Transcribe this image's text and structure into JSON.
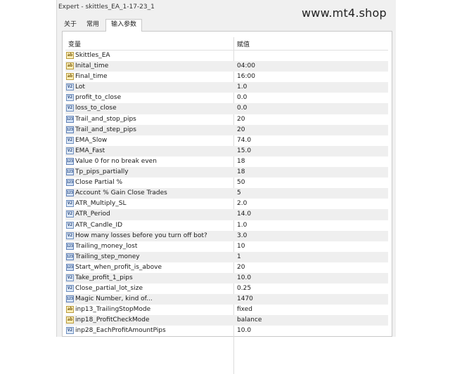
{
  "window": {
    "title": "Expert - skittles_EA_1-17-23_1",
    "watermark": "www.mt4.shop"
  },
  "tabs": [
    {
      "label": "关于",
      "active": false
    },
    {
      "label": "常用",
      "active": false
    },
    {
      "label": "输入参数",
      "active": true
    }
  ],
  "table": {
    "col_variable": "变量",
    "col_value": "赋值",
    "root": {
      "name": "Skittles_EA",
      "icon": "ab"
    },
    "rows": [
      {
        "icon": "ab",
        "name": "Inital_time",
        "value": "04:00"
      },
      {
        "icon": "ab",
        "name": "Final_time",
        "value": "16:00"
      },
      {
        "icon": "dbl",
        "name": "Lot",
        "value": "1.0"
      },
      {
        "icon": "dbl",
        "name": "profit_to_close",
        "value": "0.0"
      },
      {
        "icon": "dbl",
        "name": "loss_to_close",
        "value": "0.0"
      },
      {
        "icon": "int",
        "name": "Trail_and_stop_pips",
        "value": "20"
      },
      {
        "icon": "int",
        "name": "Trail_and_step_pips",
        "value": "20"
      },
      {
        "icon": "dbl",
        "name": "EMA_Slow",
        "value": "74.0"
      },
      {
        "icon": "dbl",
        "name": "EMA_Fast",
        "value": "15.0"
      },
      {
        "icon": "int",
        "name": "Value 0 for no break even",
        "value": "18"
      },
      {
        "icon": "int",
        "name": "Tp_pips_partially",
        "value": "18"
      },
      {
        "icon": "int",
        "name": "Close Partial %",
        "value": "50"
      },
      {
        "icon": "int",
        "name": "Account % Gain Close Trades",
        "value": "5"
      },
      {
        "icon": "dbl",
        "name": "ATR_Multiply_SL",
        "value": "2.0"
      },
      {
        "icon": "dbl",
        "name": "ATR_Period",
        "value": "14.0"
      },
      {
        "icon": "dbl",
        "name": "ATR_Candle_ID",
        "value": "1.0"
      },
      {
        "icon": "dbl",
        "name": "How many losses before you turn off bot?",
        "value": "3.0"
      },
      {
        "icon": "int",
        "name": "Trailing_money_lost",
        "value": "10"
      },
      {
        "icon": "int",
        "name": "Trailing_step_money",
        "value": "1"
      },
      {
        "icon": "int",
        "name": "Start_when_profit_is_above",
        "value": "20"
      },
      {
        "icon": "dbl",
        "name": "Take_profit_1_pips",
        "value": "10.0"
      },
      {
        "icon": "dbl",
        "name": "Close_partial_lot_size",
        "value": "0.25"
      },
      {
        "icon": "int",
        "name": "Magic Number, kind of...",
        "value": "1470"
      },
      {
        "icon": "ab",
        "name": "inp13_TrailingStopMode",
        "value": "fixed"
      },
      {
        "icon": "ab",
        "name": "inp18_ProfitCheckMode",
        "value": "balance"
      },
      {
        "icon": "dbl",
        "name": "inp28_EachProfitAmountPips",
        "value": "10.0"
      }
    ]
  }
}
